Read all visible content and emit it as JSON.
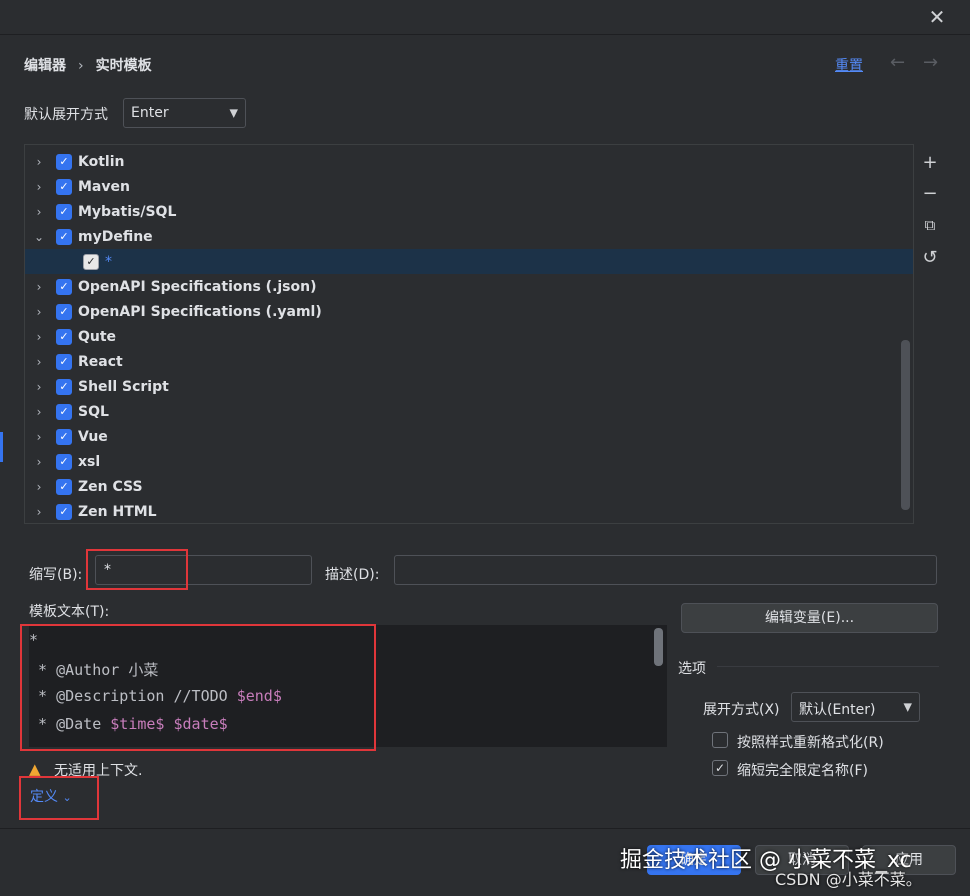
{
  "breadcrumb": {
    "parent": "编辑器",
    "separator": "›",
    "current": "实时模板"
  },
  "header": {
    "reset_label": "重置",
    "back_icon": "←",
    "forward_icon": "→",
    "close_icon": "✕"
  },
  "expand": {
    "label": "默认展开方式",
    "value": "Enter"
  },
  "tree": {
    "items": [
      {
        "label": "Kotlin",
        "expanded": false,
        "checked": true,
        "child": false
      },
      {
        "label": "Maven",
        "expanded": false,
        "checked": true,
        "child": false
      },
      {
        "label": "Mybatis/SQL",
        "expanded": false,
        "checked": true,
        "child": false
      },
      {
        "label": "myDefine",
        "expanded": true,
        "checked": true,
        "child": false
      },
      {
        "label": "*",
        "expanded": false,
        "checked": true,
        "child": true
      },
      {
        "label": "OpenAPI Specifications (.json)",
        "expanded": false,
        "checked": true,
        "child": false
      },
      {
        "label": "OpenAPI Specifications (.yaml)",
        "expanded": false,
        "checked": true,
        "child": false
      },
      {
        "label": "Qute",
        "expanded": false,
        "checked": true,
        "child": false
      },
      {
        "label": "React",
        "expanded": false,
        "checked": true,
        "child": false
      },
      {
        "label": "Shell Script",
        "expanded": false,
        "checked": true,
        "child": false
      },
      {
        "label": "SQL",
        "expanded": false,
        "checked": true,
        "child": false
      },
      {
        "label": "Vue",
        "expanded": false,
        "checked": true,
        "child": false
      },
      {
        "label": "xsl",
        "expanded": false,
        "checked": true,
        "child": false
      },
      {
        "label": "Zen CSS",
        "expanded": false,
        "checked": true,
        "child": false
      },
      {
        "label": "Zen HTML",
        "expanded": false,
        "checked": true,
        "child": false
      }
    ]
  },
  "side_tools": {
    "add": "+",
    "remove": "−",
    "copy": "⧉",
    "restore": "↺"
  },
  "abbrev": {
    "label": "缩写(B):",
    "value": "*"
  },
  "description": {
    "label": "描述(D):",
    "value": ""
  },
  "template": {
    "label": "模板文本(T):",
    "lines": [
      [
        {
          "t": "*",
          "v": false
        }
      ],
      [
        {
          "t": " * @Author 小菜",
          "v": false
        }
      ],
      [
        {
          "t": " * @Description //TODO ",
          "v": false
        },
        {
          "t": "$end$",
          "v": true
        }
      ],
      [
        {
          "t": " * @Date ",
          "v": false
        },
        {
          "t": "$time$",
          "v": true
        },
        {
          "t": " ",
          "v": false
        },
        {
          "t": "$date$",
          "v": true
        }
      ]
    ]
  },
  "edit_vars_label": "编辑变量(E)...",
  "options": {
    "title": "选项",
    "expand_label": "展开方式(X)",
    "expand_value": "默认(Enter)",
    "reformat_label": "按照样式重新格式化(R)",
    "reformat_checked": false,
    "shorten_label": "缩短完全限定名称(F)",
    "shorten_checked": true
  },
  "warning": {
    "icon": "warning-icon",
    "text": "无适用上下文."
  },
  "define_label": "定义",
  "footer": {
    "ok": "确定",
    "cancel": "取消",
    "apply": "应用"
  },
  "watermark": {
    "main": "掘金技术社区 @ 小菜不菜_xc",
    "sub": "CSDN @小菜不菜。"
  },
  "colors": {
    "accent": "#3574f0",
    "link": "#548af7",
    "highlight_box": "#e0363a",
    "template_var": "#c77dbb"
  }
}
